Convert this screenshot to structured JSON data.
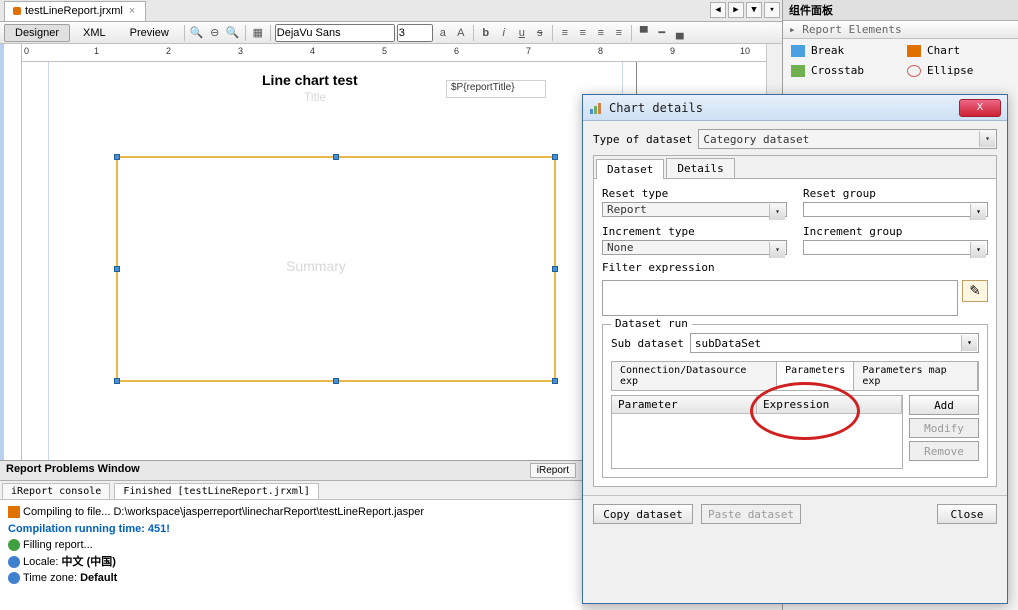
{
  "file_tab": {
    "name": "testLineReport.jrxml",
    "close": "×"
  },
  "nav": {
    "prev": "◀",
    "next": "▶",
    "down": "▼",
    "menu": "▾"
  },
  "view_modes": {
    "designer": "Designer",
    "xml": "XML",
    "preview": "Preview"
  },
  "toolbar": {
    "font": "DejaVu Sans",
    "size": "3"
  },
  "ruler_ticks": [
    "0",
    "1",
    "2",
    "3",
    "4",
    "5",
    "6",
    "7",
    "8",
    "9",
    "10"
  ],
  "canvas": {
    "title_text": "Line chart test",
    "title_placeholder": "Title",
    "param_field": "$P{reportTitle}",
    "summary_label": "Summary"
  },
  "palette": {
    "title": "组件面板",
    "section": "Report Elements",
    "items": [
      {
        "label": "Break",
        "color": "#4aa0e0"
      },
      {
        "label": "Chart",
        "color": "#e07000"
      },
      {
        "label": "Crosstab",
        "color": "#70b050"
      },
      {
        "label": "Ellipse",
        "color": "#d06060"
      }
    ]
  },
  "problems": {
    "title": "Report Problems Window",
    "right_tab": "iReport",
    "tabs": {
      "console": "iReport console",
      "finished": "Finished [testLineReport.jrxml]"
    },
    "log": {
      "line1": "Compiling to file... D:\\workspace\\jasperreport\\linecharReport\\testLineReport.jasper",
      "line2": "Compilation running time: 451!",
      "line3": "Filling report...",
      "line4_label": "Locale: ",
      "line4_value": "中文 (中国)",
      "line5_label": "Time zone: ",
      "line5_value": "Default"
    }
  },
  "dialog": {
    "title": "Chart details",
    "close": "X",
    "type_of_dataset_label": "Type of dataset",
    "type_of_dataset_value": "Category dataset",
    "tabs": {
      "dataset": "Dataset",
      "details": "Details"
    },
    "reset_type_label": "Reset type",
    "reset_type_value": "Report",
    "reset_group_label": "Reset group",
    "reset_group_value": "",
    "increment_type_label": "Increment type",
    "increment_type_value": "None",
    "increment_group_label": "Increment group",
    "increment_group_value": "",
    "filter_label": "Filter expression",
    "dataset_run_legend": "Dataset run",
    "sub_dataset_label": "Sub dataset",
    "sub_dataset_value": "subDataSet",
    "inner_tabs": {
      "conn": "Connection/Datasource exp",
      "params": "Parameters",
      "map": "Parameters map exp"
    },
    "param_table": {
      "col1": "Parameter",
      "col2": "Expression"
    },
    "buttons": {
      "add": "Add",
      "modify": "Modify",
      "remove": "Remove",
      "copy": "Copy dataset",
      "paste": "Paste dataset",
      "close": "Close"
    }
  }
}
